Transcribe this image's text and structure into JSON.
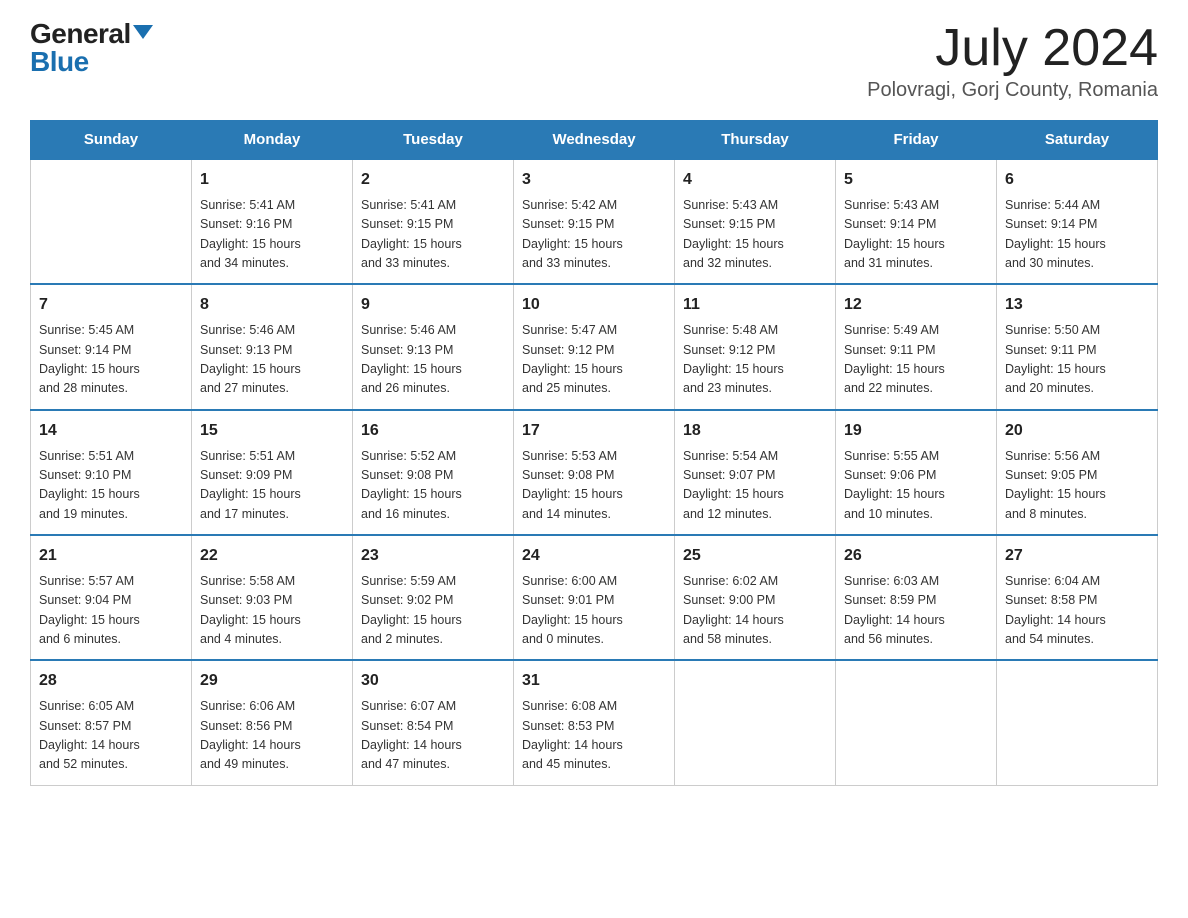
{
  "header": {
    "logo_general": "General",
    "logo_blue": "Blue",
    "title": "July 2024",
    "subtitle": "Polovragi, Gorj County, Romania"
  },
  "days_of_week": [
    "Sunday",
    "Monday",
    "Tuesday",
    "Wednesday",
    "Thursday",
    "Friday",
    "Saturday"
  ],
  "weeks": [
    [
      {
        "day": "",
        "info": ""
      },
      {
        "day": "1",
        "info": "Sunrise: 5:41 AM\nSunset: 9:16 PM\nDaylight: 15 hours\nand 34 minutes."
      },
      {
        "day": "2",
        "info": "Sunrise: 5:41 AM\nSunset: 9:15 PM\nDaylight: 15 hours\nand 33 minutes."
      },
      {
        "day": "3",
        "info": "Sunrise: 5:42 AM\nSunset: 9:15 PM\nDaylight: 15 hours\nand 33 minutes."
      },
      {
        "day": "4",
        "info": "Sunrise: 5:43 AM\nSunset: 9:15 PM\nDaylight: 15 hours\nand 32 minutes."
      },
      {
        "day": "5",
        "info": "Sunrise: 5:43 AM\nSunset: 9:14 PM\nDaylight: 15 hours\nand 31 minutes."
      },
      {
        "day": "6",
        "info": "Sunrise: 5:44 AM\nSunset: 9:14 PM\nDaylight: 15 hours\nand 30 minutes."
      }
    ],
    [
      {
        "day": "7",
        "info": "Sunrise: 5:45 AM\nSunset: 9:14 PM\nDaylight: 15 hours\nand 28 minutes."
      },
      {
        "day": "8",
        "info": "Sunrise: 5:46 AM\nSunset: 9:13 PM\nDaylight: 15 hours\nand 27 minutes."
      },
      {
        "day": "9",
        "info": "Sunrise: 5:46 AM\nSunset: 9:13 PM\nDaylight: 15 hours\nand 26 minutes."
      },
      {
        "day": "10",
        "info": "Sunrise: 5:47 AM\nSunset: 9:12 PM\nDaylight: 15 hours\nand 25 minutes."
      },
      {
        "day": "11",
        "info": "Sunrise: 5:48 AM\nSunset: 9:12 PM\nDaylight: 15 hours\nand 23 minutes."
      },
      {
        "day": "12",
        "info": "Sunrise: 5:49 AM\nSunset: 9:11 PM\nDaylight: 15 hours\nand 22 minutes."
      },
      {
        "day": "13",
        "info": "Sunrise: 5:50 AM\nSunset: 9:11 PM\nDaylight: 15 hours\nand 20 minutes."
      }
    ],
    [
      {
        "day": "14",
        "info": "Sunrise: 5:51 AM\nSunset: 9:10 PM\nDaylight: 15 hours\nand 19 minutes."
      },
      {
        "day": "15",
        "info": "Sunrise: 5:51 AM\nSunset: 9:09 PM\nDaylight: 15 hours\nand 17 minutes."
      },
      {
        "day": "16",
        "info": "Sunrise: 5:52 AM\nSunset: 9:08 PM\nDaylight: 15 hours\nand 16 minutes."
      },
      {
        "day": "17",
        "info": "Sunrise: 5:53 AM\nSunset: 9:08 PM\nDaylight: 15 hours\nand 14 minutes."
      },
      {
        "day": "18",
        "info": "Sunrise: 5:54 AM\nSunset: 9:07 PM\nDaylight: 15 hours\nand 12 minutes."
      },
      {
        "day": "19",
        "info": "Sunrise: 5:55 AM\nSunset: 9:06 PM\nDaylight: 15 hours\nand 10 minutes."
      },
      {
        "day": "20",
        "info": "Sunrise: 5:56 AM\nSunset: 9:05 PM\nDaylight: 15 hours\nand 8 minutes."
      }
    ],
    [
      {
        "day": "21",
        "info": "Sunrise: 5:57 AM\nSunset: 9:04 PM\nDaylight: 15 hours\nand 6 minutes."
      },
      {
        "day": "22",
        "info": "Sunrise: 5:58 AM\nSunset: 9:03 PM\nDaylight: 15 hours\nand 4 minutes."
      },
      {
        "day": "23",
        "info": "Sunrise: 5:59 AM\nSunset: 9:02 PM\nDaylight: 15 hours\nand 2 minutes."
      },
      {
        "day": "24",
        "info": "Sunrise: 6:00 AM\nSunset: 9:01 PM\nDaylight: 15 hours\nand 0 minutes."
      },
      {
        "day": "25",
        "info": "Sunrise: 6:02 AM\nSunset: 9:00 PM\nDaylight: 14 hours\nand 58 minutes."
      },
      {
        "day": "26",
        "info": "Sunrise: 6:03 AM\nSunset: 8:59 PM\nDaylight: 14 hours\nand 56 minutes."
      },
      {
        "day": "27",
        "info": "Sunrise: 6:04 AM\nSunset: 8:58 PM\nDaylight: 14 hours\nand 54 minutes."
      }
    ],
    [
      {
        "day": "28",
        "info": "Sunrise: 6:05 AM\nSunset: 8:57 PM\nDaylight: 14 hours\nand 52 minutes."
      },
      {
        "day": "29",
        "info": "Sunrise: 6:06 AM\nSunset: 8:56 PM\nDaylight: 14 hours\nand 49 minutes."
      },
      {
        "day": "30",
        "info": "Sunrise: 6:07 AM\nSunset: 8:54 PM\nDaylight: 14 hours\nand 47 minutes."
      },
      {
        "day": "31",
        "info": "Sunrise: 6:08 AM\nSunset: 8:53 PM\nDaylight: 14 hours\nand 45 minutes."
      },
      {
        "day": "",
        "info": ""
      },
      {
        "day": "",
        "info": ""
      },
      {
        "day": "",
        "info": ""
      }
    ]
  ]
}
